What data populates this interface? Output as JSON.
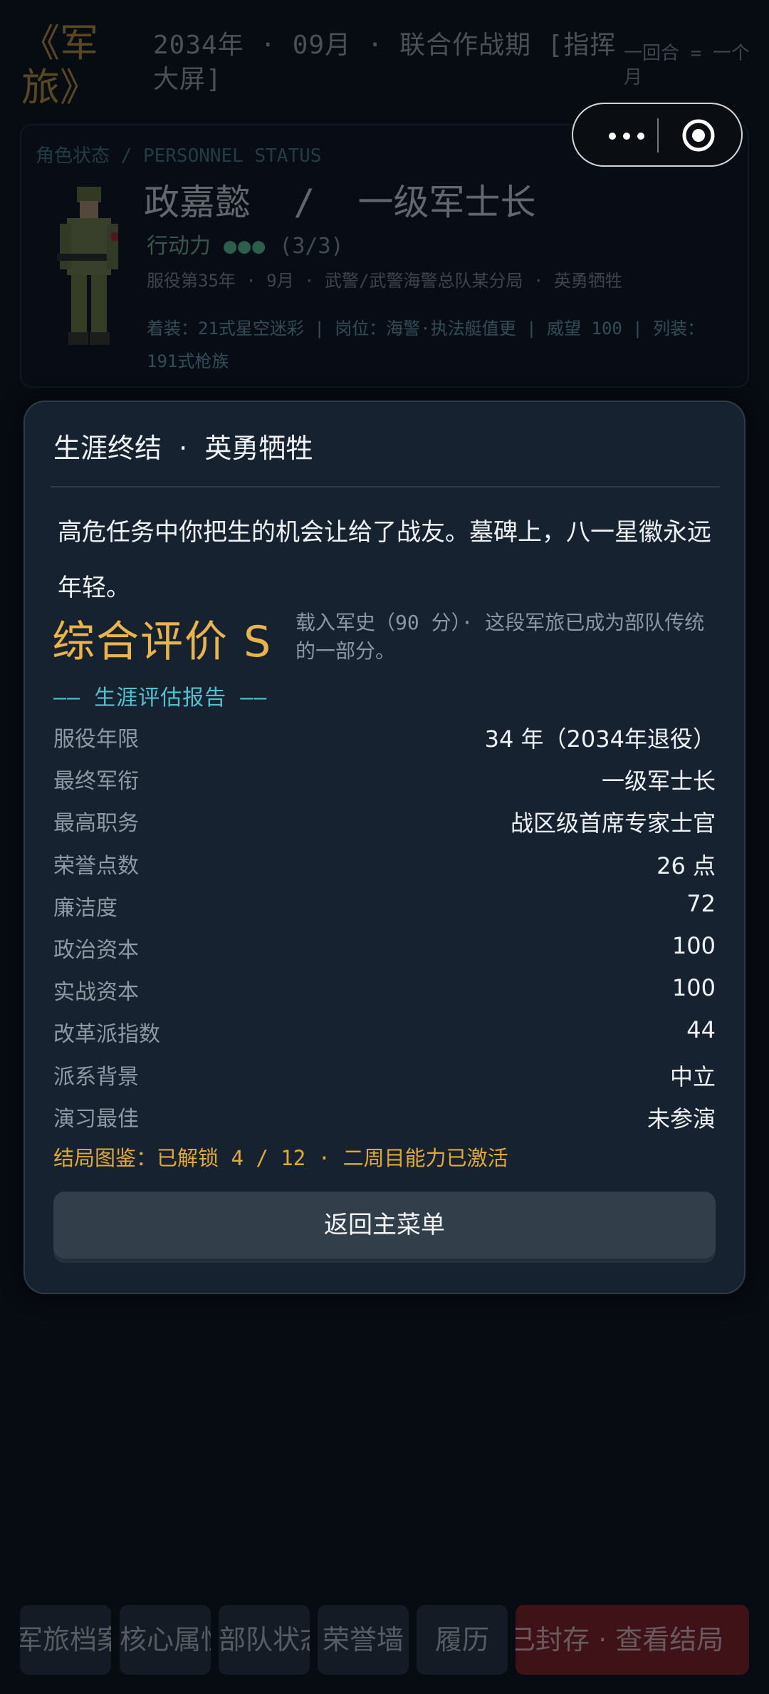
{
  "header": {
    "logo": "《军旅》",
    "dateline": "2034年 · 09月 · 联合作战期 [指挥大屏]",
    "turn_note": "一回合 = 一个月"
  },
  "capsule": {
    "more_icon": "more-dots-icon",
    "close_icon": "target-circle-icon"
  },
  "status": {
    "title": "角色状态 / PERSONNEL STATUS",
    "name": "政嘉懿  /  一级军士长",
    "ap_label": "行动力",
    "ap_dots": "●●●",
    "ap_count": "(3/3)",
    "meta": "服役第35年 · 9月 · 武警/武警海警总队某分局 · 英勇牺牲",
    "gear": "着装：21式星空迷彩 | 岗位：海警·执法艇值更 | 威望 100 | 列装：191式枪族"
  },
  "modal": {
    "title": "生涯终结  ·  英勇牺牲",
    "story": "高危任务中你把生的机会让给了战友。墓碑上，八一星徽永远年轻。",
    "grade": "综合评价 S",
    "grade_note": "载入军史（90 分）· 这段军旅已成为部队传统的一部分。",
    "report_heading": "—— 生涯评估报告 ——",
    "rows": [
      {
        "k": "服役年限",
        "v": "34 年（2034年退役）"
      },
      {
        "k": "最终军衔",
        "v": "一级军士长"
      },
      {
        "k": "最高职务",
        "v": "战区级首席专家士官"
      },
      {
        "k": "荣誉点数",
        "v": "26 点"
      },
      {
        "k": "廉洁度",
        "v": "72"
      },
      {
        "k": "政治资本",
        "v": "100"
      },
      {
        "k": "实战资本",
        "v": "100"
      },
      {
        "k": "改革派指数",
        "v": "44"
      },
      {
        "k": "派系背景",
        "v": "中立"
      },
      {
        "k": "演习最佳",
        "v": "未参演"
      }
    ],
    "ending_note": "结局图鉴：已解锁 4 / 12  ·  二周目能力已激活",
    "button": "返回主菜单"
  },
  "tabs": [
    {
      "label": "军旅档案"
    },
    {
      "label": "核心属性"
    },
    {
      "label": "部队状态"
    },
    {
      "label": "荣誉墙"
    },
    {
      "label": "履历"
    },
    {
      "label": "已封存  ·  查看结局"
    }
  ]
}
